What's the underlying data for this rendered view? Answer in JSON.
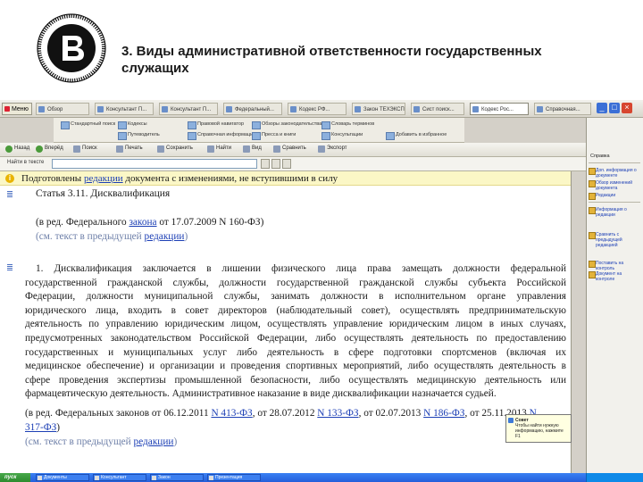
{
  "slide": {
    "title_line1": "3. Виды административной ответственности государственных",
    "title_line2": "служащих"
  },
  "app": {
    "menu_label": "Меню",
    "top_tabs": [
      "Обзор",
      "Консультант П...",
      "Консультант П...",
      "Федеральный...",
      "Кодекс РФ...",
      "Закон ТЕХЭКСПЕРТ",
      "Сист поиск...",
      "Кодекс Рос...",
      "Справочная..."
    ],
    "ribbon": [
      "Стандартный поиск",
      "Кодексы",
      "Путеводитель",
      "Правовой навигатор",
      "Справочная информация",
      "Обзоры законодательства",
      "Пресса и книги",
      "Словарь терминов",
      "Консультации",
      "Добавить в избранное"
    ],
    "toolbar": [
      "Назад",
      "Вперёд",
      "Поиск",
      "Печать",
      "Сохранить",
      "Найти",
      "Вид",
      "Сравнить",
      "Экспорт"
    ],
    "search_label": "Найти в тексте",
    "search_value": "",
    "search_placeholder": ""
  },
  "document": {
    "notice_prefix": "Подготовлены ",
    "notice_link": "редакции",
    "notice_suffix": " документа с изменениями, не вступившими в силу",
    "article_title": "Статья 3.11. Дисквалификация",
    "amend1_prefix": "(в ред. Федерального ",
    "amend1_link": "закона",
    "amend1_suffix": " от 17.07.2009 N 160-ФЗ)",
    "seetext1_prefix": "(см. текст в предыдущей ",
    "seetext1_link": "редакции",
    "seetext1_suffix": ")",
    "para_lines": [
      "1. Дисквалификация заключается в лишении физического лица права замещать должности федеральной",
      "государственной гражданской службы, должности государственной гражданской службы субъекта Российской",
      "Федерации, должности муниципальной службы, занимать должности в исполнительном органе управления",
      "юридического лица, входить в совет директоров (наблюдательный совет), осуществлять предпринимательскую",
      "деятельность по управлению юридическим лицом, осуществлять управление юридическим лицом в иных случаях,",
      "предусмотренных законодательством Российской Федерации, либо осуществлять деятельность по предоставлению",
      "государственных и муниципальных услуг либо деятельность в сфере подготовки спортсменов (включая их",
      "медицинское обеспечение) и организации и проведения спортивных мероприятий, либо осуществлять деятельность в",
      "сфере проведения экспертизы промышленной безопасности, либо осуществлять медицинскую деятельность или",
      "фармацевтическую деятельность. Административное наказание в виде дисквалификации назначается судьей."
    ],
    "amend2_prefix": "(в ред. Федеральных законов от 06.12.2011 ",
    "amend2_link1": "N 413-ФЗ",
    "amend2_mid1": ", от 28.07.2012 ",
    "amend2_link2": "N 133-ФЗ",
    "amend2_mid2": ", от 02.07.2013 ",
    "amend2_link3": "N 186-ФЗ",
    "amend2_mid3": ", от 25.11.2013 ",
    "amend2_link4": "N",
    "amend2_line2_link": "317-ФЗ",
    "amend2_line2_suffix": ")",
    "seetext2_prefix": "(см. текст в предыдущей ",
    "seetext2_link": "редакции",
    "seetext2_suffix": ")"
  },
  "popup": {
    "title": "Совет",
    "text": "Чтобы найти нужную информацию, нажмите F1"
  },
  "right_panel": {
    "header": "Справка",
    "items": [
      "Доп. информация о документе",
      "Обзор изменений документа",
      "Редакции",
      "Информация о редакции",
      "Сравнить с предыдущей редакцией",
      "Поставить на контроль",
      "Документ на контроле"
    ]
  },
  "taskbar": {
    "start": "пуск",
    "items": [
      "Документы",
      "Консультант",
      "Закон",
      "Презентация"
    ]
  },
  "colors": {
    "link": "#1c3fb5",
    "notice_bg": "#fbf7c6",
    "taskbar": "#245edb",
    "start_button": "#2d8b2f"
  }
}
